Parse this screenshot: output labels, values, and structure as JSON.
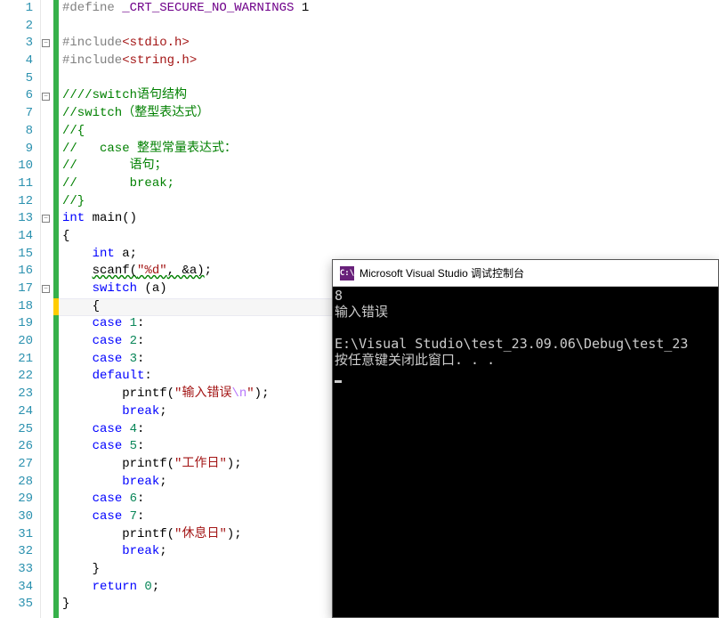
{
  "editor": {
    "line_count": 35,
    "current_line": 18,
    "fold_markers": [
      {
        "line": 3,
        "sym": "−"
      },
      {
        "line": 6,
        "sym": "−"
      },
      {
        "line": 13,
        "sym": "−"
      },
      {
        "line": 17,
        "sym": "−"
      }
    ],
    "code": {
      "l1": {
        "pre": "#define ",
        "macro": "_CRT_SECURE_NO_WARNINGS",
        "rest": " 1"
      },
      "l3": {
        "pre": "#include",
        "hdr": "<stdio.h>"
      },
      "l4": {
        "pre": "#include",
        "hdr": "<string.h>"
      },
      "l6": "////switch语句结构",
      "l7": "//switch（整型表达式）",
      "l8": "//{",
      "l9": "//   case 整型常量表达式：",
      "l10": "//       语句；",
      "l11": "//       break;",
      "l12": "//}",
      "l13": {
        "kw1": "int ",
        "fn": "main",
        "paren": "()"
      },
      "l14": "{",
      "l15": {
        "indent": "    ",
        "kw": "int ",
        "rest": "a;"
      },
      "l16": {
        "indent": "    ",
        "fn": "scanf",
        "open": "(",
        "str": "\"%d\"",
        "mid": ", &a)",
        "semi": ";"
      },
      "l17": {
        "indent": "    ",
        "kw": "switch ",
        "rest": "(a)"
      },
      "l18": "    {",
      "l19": {
        "indent": "    ",
        "kw": "case ",
        "num": "1",
        "rest": ":"
      },
      "l20": {
        "indent": "    ",
        "kw": "case ",
        "num": "2",
        "rest": ":"
      },
      "l21": {
        "indent": "    ",
        "kw": "case ",
        "num": "3",
        "rest": ":"
      },
      "l22": {
        "indent": "    ",
        "kw": "default",
        "rest": ":"
      },
      "l23": {
        "indent": "        ",
        "fn": "printf",
        "open": "(",
        "str": "\"输入错误",
        "esc": "\\n",
        "strend": "\"",
        "close": ");"
      },
      "l24": {
        "indent": "        ",
        "kw": "break",
        "rest": ";"
      },
      "l25": {
        "indent": "    ",
        "kw": "case ",
        "num": "4",
        "rest": ":"
      },
      "l26": {
        "indent": "    ",
        "kw": "case ",
        "num": "5",
        "rest": ":"
      },
      "l27": {
        "indent": "        ",
        "fn": "printf",
        "open": "(",
        "str": "\"工作日\"",
        "close": ");"
      },
      "l28": {
        "indent": "        ",
        "kw": "break",
        "rest": ";"
      },
      "l29": {
        "indent": "    ",
        "kw": "case ",
        "num": "6",
        "rest": ":"
      },
      "l30": {
        "indent": "    ",
        "kw": "case ",
        "num": "7",
        "rest": ":"
      },
      "l31": {
        "indent": "        ",
        "fn": "printf",
        "open": "(",
        "str": "\"休息日\"",
        "close": ");"
      },
      "l32": {
        "indent": "        ",
        "kw": "break",
        "rest": ";"
      },
      "l33": "    }",
      "l34": {
        "indent": "    ",
        "kw": "return ",
        "num": "0",
        "rest": ";"
      },
      "l35": "}"
    }
  },
  "console": {
    "icon_text": "C:\\",
    "title": "Microsoft Visual Studio 调试控制台",
    "out_line1": "8",
    "out_line2": "输入错误",
    "out_line3": "",
    "out_line4": "E:\\Visual Studio\\test_23.09.06\\Debug\\test_23",
    "out_line5": "按任意键关闭此窗口. . ."
  }
}
